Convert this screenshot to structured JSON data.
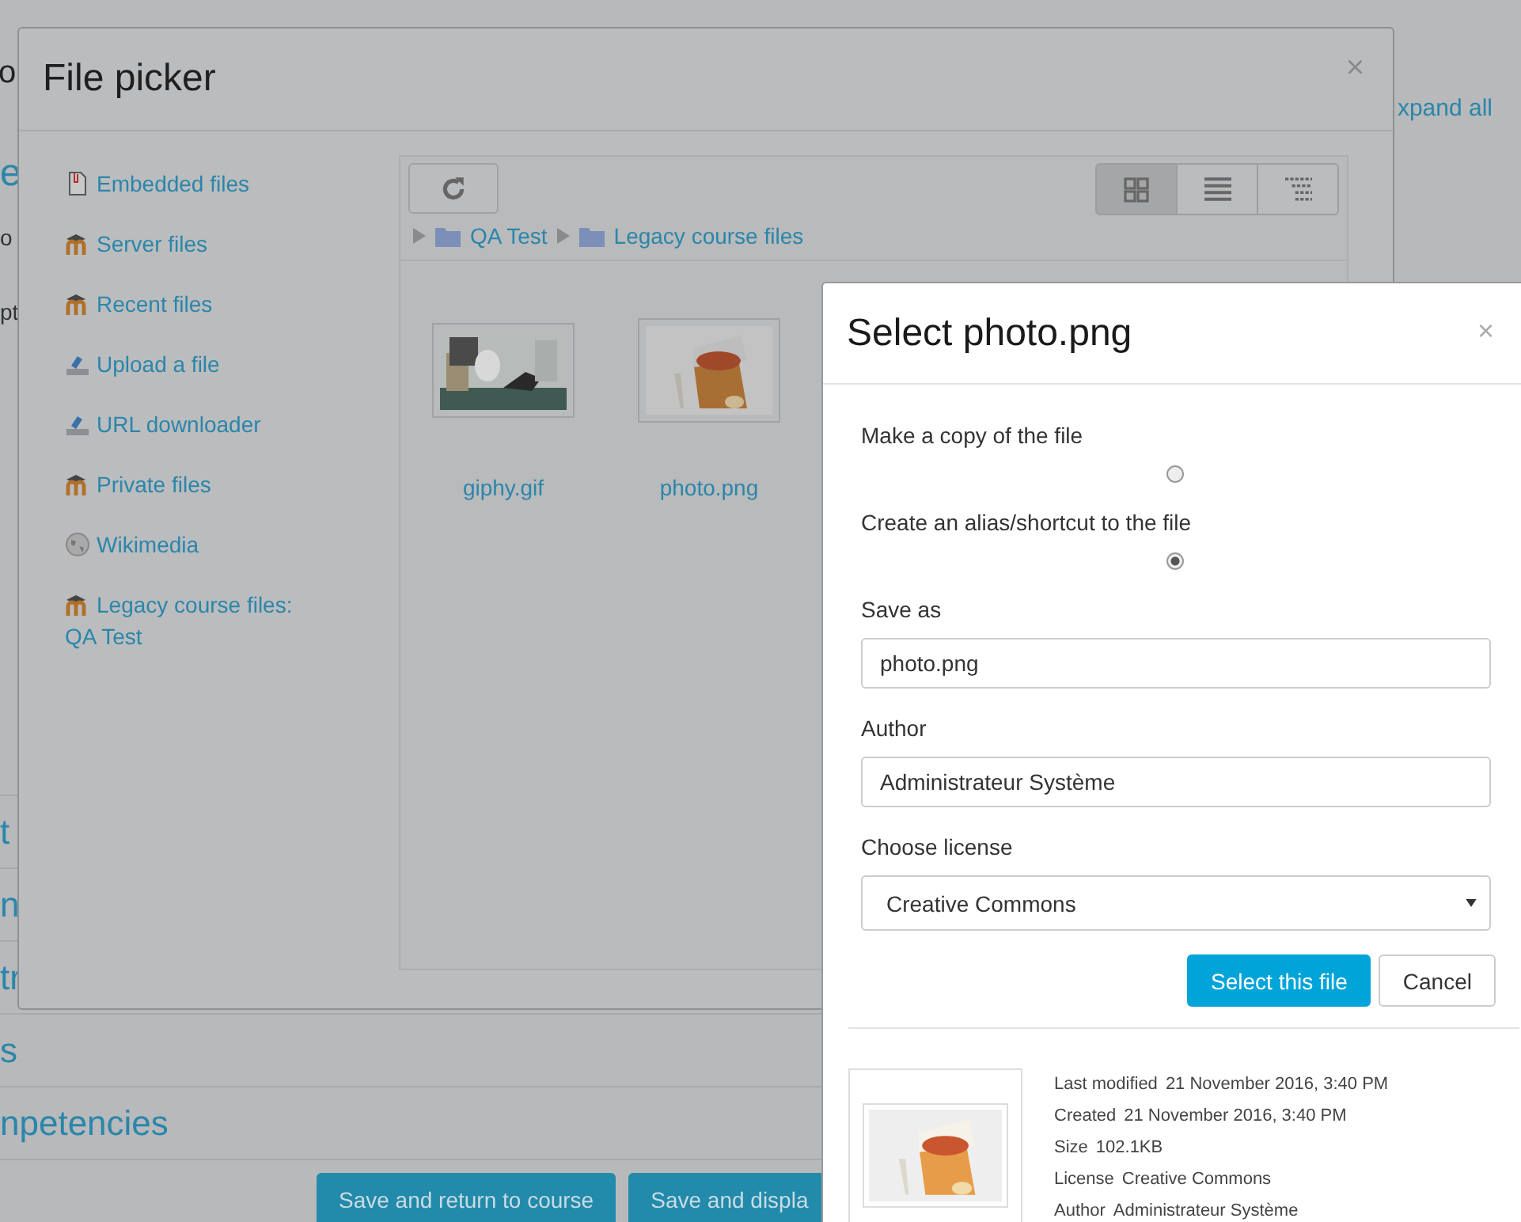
{
  "page": {
    "heading": "o",
    "link": "e",
    "text_1": "o",
    "text_2": "pt",
    "expand_all": "xpand all",
    "sections": [
      "t",
      "n",
      "tr",
      "s",
      "npetencies"
    ],
    "buttons": [
      "Save and return to course",
      "Save and displa"
    ]
  },
  "file_picker": {
    "title": "File picker",
    "close": "×",
    "repositories": [
      {
        "label": "Embedded files",
        "kind": "document"
      },
      {
        "label": "Server files",
        "kind": "moodle"
      },
      {
        "label": "Recent files",
        "kind": "moodle"
      },
      {
        "label": "Upload a file",
        "kind": "upload"
      },
      {
        "label": "URL downloader",
        "kind": "upload"
      },
      {
        "label": "Private files",
        "kind": "moodle"
      },
      {
        "label": "Wikimedia",
        "kind": "globe"
      },
      {
        "label": "Legacy course files: QA Test",
        "kind": "moodle"
      }
    ],
    "views": [
      {
        "kind": "icons",
        "selected": true
      },
      {
        "kind": "list",
        "selected": false
      },
      {
        "kind": "tree",
        "selected": false
      }
    ],
    "breadcrumb": [
      "QA Test",
      "Legacy course files"
    ],
    "files": [
      {
        "name": "giphy.gif"
      },
      {
        "name": "photo.png"
      }
    ]
  },
  "select_dialog": {
    "title": "Select photo.png",
    "close": "×",
    "options": [
      {
        "label": "Make a copy of the file",
        "selected": false
      },
      {
        "label": "Create an alias/shortcut to the file",
        "selected": true
      }
    ],
    "save_as": {
      "label": "Save as",
      "value": "photo.png"
    },
    "author": {
      "label": "Author",
      "value": "Administrateur Système"
    },
    "license": {
      "label": "Choose license",
      "value": "Creative Commons"
    },
    "buttons": [
      {
        "label": "Select this file",
        "kind": "primary"
      },
      {
        "label": "Cancel",
        "kind": "secondary"
      }
    ],
    "details": [
      {
        "label": "Last modified",
        "value": "21 November 2016, 3:40 PM"
      },
      {
        "label": "Created",
        "value": "21 November 2016, 3:40 PM"
      },
      {
        "label": "Size",
        "value": "102.1KB"
      },
      {
        "label": "License",
        "value": "Creative Commons"
      },
      {
        "label": "Author",
        "value": "Administrateur Système"
      }
    ]
  }
}
